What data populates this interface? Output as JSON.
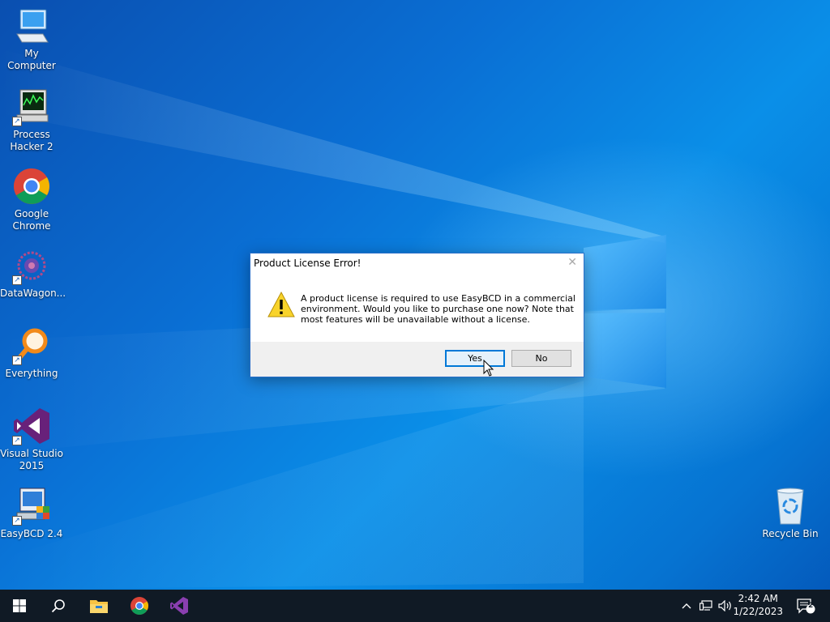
{
  "desktop": {
    "icons": [
      {
        "label": "My Computer",
        "icon": "computer-icon"
      },
      {
        "label": "Process Hacker 2",
        "icon": "process-hacker-icon"
      },
      {
        "label": "Google Chrome",
        "icon": "chrome-icon"
      },
      {
        "label": "DataWagon...",
        "icon": "datawagon-icon"
      },
      {
        "label": "Everything",
        "icon": "everything-search-icon"
      },
      {
        "label": "Visual Studio 2015",
        "icon": "visual-studio-icon"
      },
      {
        "label": "EasyBCD 2.4",
        "icon": "easybcd-icon"
      },
      {
        "label": "Recycle Bin",
        "icon": "recycle-bin-icon"
      }
    ]
  },
  "dialog": {
    "title": "Product License Error!",
    "message": "A product license is required to use EasyBCD in a commercial environment. Would you like to purchase one now? Note that most features will be unavailable without a license.",
    "yes_label": "Yes",
    "no_label": "No",
    "icon": "warning-icon"
  },
  "taskbar": {
    "pinned": [
      "start-icon",
      "search-icon",
      "file-explorer-icon",
      "chrome-icon",
      "visual-studio-icon"
    ],
    "time": "2:42 AM",
    "date": "1/22/2023",
    "notification_count": "2"
  },
  "colors": {
    "accent": "#0078d7",
    "taskbar": "#101a25",
    "desktop": "#0a6fd4"
  }
}
